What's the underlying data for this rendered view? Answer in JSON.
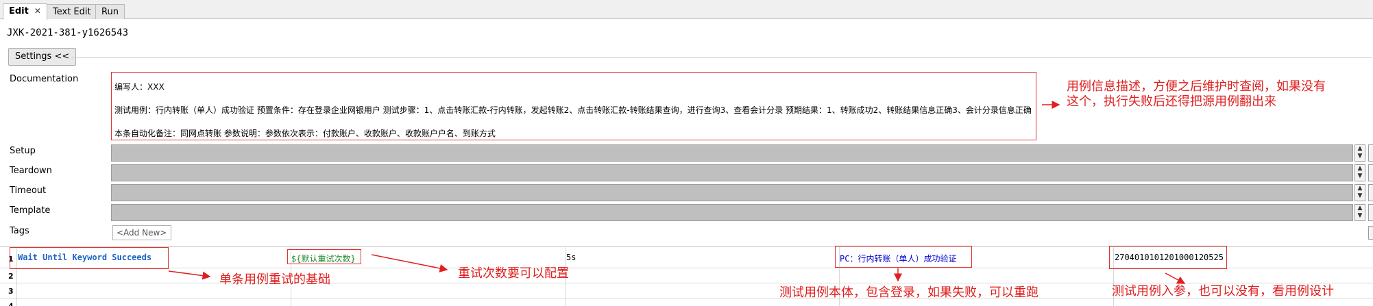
{
  "tabs": [
    {
      "label": "Edit",
      "active": true
    },
    {
      "label": "Text Edit",
      "active": false
    },
    {
      "label": "Run",
      "active": false
    }
  ],
  "case_title": "JXK-2021-381-y1626543",
  "settings_button": "Settings <<",
  "labels": {
    "documentation": "Documentation",
    "setup": "Setup",
    "teardown": "Teardown",
    "timeout": "Timeout",
    "template": "Template",
    "tags": "Tags"
  },
  "documentation_lines": [
    "编写人：XXX",
    "测试用例：行内转账（单人）成功验证 预置条件：存在登录企业网银用户 测试步骤：1、点击转账汇款-行内转账，发起转账2、点击转账汇款-转账结果查询，进行查询3、查看会计分录 预期结果：1、转账成功2、转账结果信息正确3、会计分录信息正确",
    "本条自动化备注：同网点转账 参数说明：参数依次表示：付款账户、收款账户、收款账户户名、到账方式"
  ],
  "tags_add_new": "<Add New>",
  "spinner_glyphs": {
    "up": "▲",
    "down": "▼"
  },
  "grid": {
    "row_numbers": [
      "1",
      "2",
      "3",
      "4"
    ],
    "row1": {
      "keyword": "Wait Until Keyword Succeeds",
      "retry_var": "${默认重试次数}",
      "interval": "5s",
      "test_keyword": "PC：行内转账（单人）成功验证",
      "param": "2704010101201000120525"
    }
  },
  "annotations": {
    "doc_note_line1": "用例信息描述，方便之后维护时查阅，如果没有",
    "doc_note_line2": "这个，执行失败后还得把源用例翻出来",
    "retry_basis": "单条用例重试的基础",
    "retry_config": "重试次数要可以配置",
    "test_body": "测试用例本体，包含登录，如果失败，可以重跑",
    "test_params": "测试用例入参，也可以没有，看用例设计"
  },
  "colors": {
    "annotation_red": "#e23030",
    "keyword_blue": "#1a63c7",
    "variable_green": "#1e8a2a",
    "field_gray": "#bfbfbf"
  }
}
